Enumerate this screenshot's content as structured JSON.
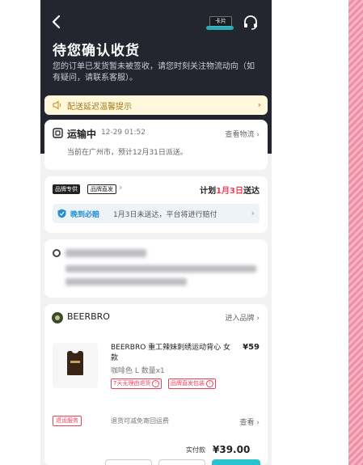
{
  "header": {
    "title": "待您确认收货",
    "description": "您的订单已发货暂未被签收，请您时刻关注物流动向（如有疑问，请联系客服）。",
    "card_label": "卡片"
  },
  "notice": {
    "text": "配送延迟温馨提示",
    "chevron": "›"
  },
  "logistics": {
    "status": "运输中",
    "time": "12-29 01:52",
    "link": "查看物流 ›",
    "location": "当前在广州市，预计12月31日派送。"
  },
  "brand_shipping": {
    "badge_exclusive": "品牌专供",
    "badge_direct": "品牌直发",
    "chevron": "›",
    "plan_prefix": "计划",
    "plan_date": "1月3日",
    "plan_suffix": "送达",
    "guarantee_title": "晚到必赔",
    "guarantee_text": "1月3日未送达，平台将进行赔付",
    "guarantee_chevron": "›"
  },
  "shop": {
    "name": "BEERBRO",
    "enter": "进入品牌 ›"
  },
  "product": {
    "title": "BEERBRO 重工辣妹刺绣运动背心 女款",
    "price": "¥59",
    "spec": "咖啡色 L 数量x1",
    "tag1": "7天无理由退货",
    "tag2": "品牌直发包装",
    "info_icon": "i"
  },
  "returns": {
    "tag": "退运服务",
    "text": "退货可减免寄回运费",
    "link": "查看 ›"
  },
  "footer": {
    "paid_label": "实付款",
    "paid_value": "¥39.00"
  },
  "colors": {
    "header_bg": "#23262f",
    "accent_red": "#ef4055",
    "accent_blue": "#1f8fd0",
    "notice_bg": "#fff8dc"
  },
  "icons": [
    "back-arrow-icon",
    "headset-icon",
    "speaker-icon",
    "truck-box-icon",
    "shield-icon",
    "location-pin-icon",
    "brand-logo-icon"
  ]
}
